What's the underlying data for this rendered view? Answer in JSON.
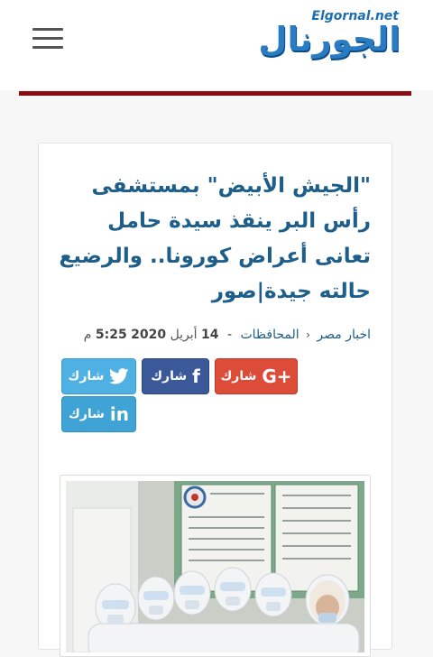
{
  "header": {
    "logo_net": "Elgornal.net",
    "logo_ar": "الجورنال"
  },
  "article": {
    "title": "\"الجيش الأبيض\" بمستشفى رأس البر ينقذ سيدة حامل تعانى أعراض كورونا.. والرضيع حالته جيدة|صور",
    "breadcrumb": {
      "category": "اخبار مصر",
      "section": "المحافظات"
    },
    "date": {
      "day": "14",
      "month": "أبريل",
      "year": "2020",
      "time": "5:25",
      "ampm": "م"
    }
  },
  "share": {
    "gplus": {
      "label": "شارك",
      "icon": "G+"
    },
    "facebook": {
      "label": "شارك",
      "icon": "f"
    },
    "twitter": {
      "label": "شارك",
      "icon": "twitter-bird"
    },
    "linkedin": {
      "label": "شارك",
      "icon": "in"
    }
  },
  "colors": {
    "accent_red": "#8b0c14",
    "title_blue": "#1d5f8a",
    "gplus": "#dd4b39",
    "facebook": "#3b5998",
    "twitter": "#4fb1e3",
    "linkedin": "#3fa3d6"
  }
}
